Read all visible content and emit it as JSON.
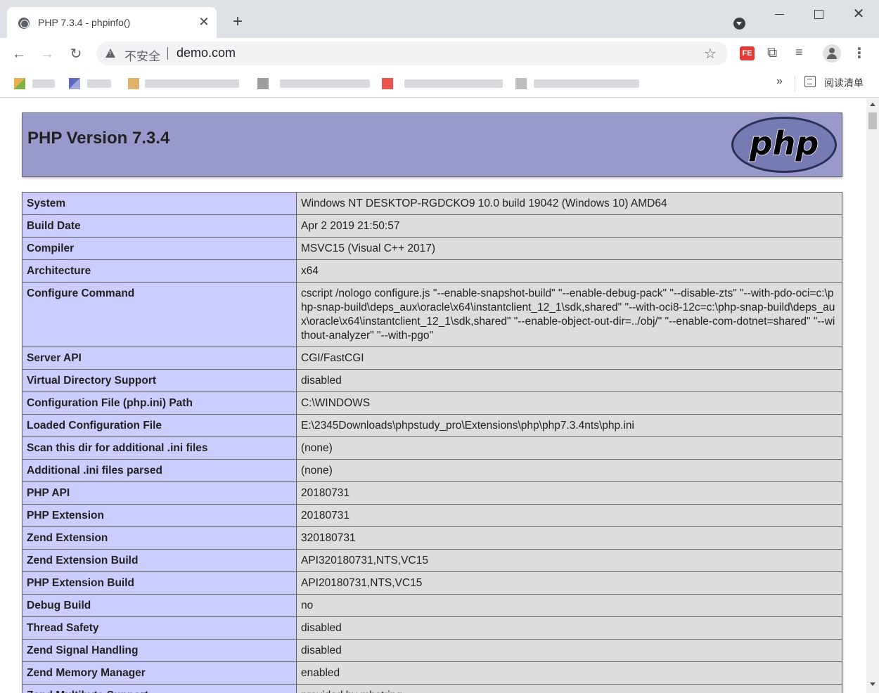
{
  "browser": {
    "tab_title": "PHP 7.3.4 - phpinfo()",
    "tab_close": "✕",
    "new_tab": "+",
    "insecure_label": "不安全",
    "url": "demo.com",
    "ext_label": "FE",
    "bookmarks_more": "»",
    "reading_list": "阅读清单"
  },
  "page": {
    "title": "PHP Version 7.3.4",
    "logo_text": "php"
  },
  "rows": [
    {
      "key": "System",
      "value": "Windows NT DESKTOP-RGDCKO9 10.0 build 19042 (Windows 10) AMD64"
    },
    {
      "key": "Build Date",
      "value": "Apr 2 2019 21:50:57"
    },
    {
      "key": "Compiler",
      "value": "MSVC15 (Visual C++ 2017)"
    },
    {
      "key": "Architecture",
      "value": "x64"
    },
    {
      "key": "Configure Command",
      "value": "cscript /nologo configure.js \"--enable-snapshot-build\" \"--enable-debug-pack\" \"--disable-zts\" \"--with-pdo-oci=c:\\php-snap-build\\deps_aux\\oracle\\x64\\instantclient_12_1\\sdk,shared\" \"--with-oci8-12c=c:\\php-snap-build\\deps_aux\\oracle\\x64\\instantclient_12_1\\sdk,shared\" \"--enable-object-out-dir=../obj/\" \"--enable-com-dotnet=shared\" \"--without-analyzer\" \"--with-pgo\""
    },
    {
      "key": "Server API",
      "value": "CGI/FastCGI"
    },
    {
      "key": "Virtual Directory Support",
      "value": "disabled"
    },
    {
      "key": "Configuration File (php.ini) Path",
      "value": "C:\\WINDOWS"
    },
    {
      "key": "Loaded Configuration File",
      "value": "E:\\2345Downloads\\phpstudy_pro\\Extensions\\php\\php7.3.4nts\\php.ini"
    },
    {
      "key": "Scan this dir for additional .ini files",
      "value": "(none)"
    },
    {
      "key": "Additional .ini files parsed",
      "value": "(none)"
    },
    {
      "key": "PHP API",
      "value": "20180731"
    },
    {
      "key": "PHP Extension",
      "value": "20180731"
    },
    {
      "key": "Zend Extension",
      "value": "320180731"
    },
    {
      "key": "Zend Extension Build",
      "value": "API320180731,NTS,VC15"
    },
    {
      "key": "PHP Extension Build",
      "value": "API20180731,NTS,VC15"
    },
    {
      "key": "Debug Build",
      "value": "no"
    },
    {
      "key": "Thread Safety",
      "value": "disabled"
    },
    {
      "key": "Zend Signal Handling",
      "value": "disabled"
    },
    {
      "key": "Zend Memory Manager",
      "value": "enabled"
    },
    {
      "key": "Zend Multibyte Support",
      "value": "provided by mbstring"
    }
  ]
}
